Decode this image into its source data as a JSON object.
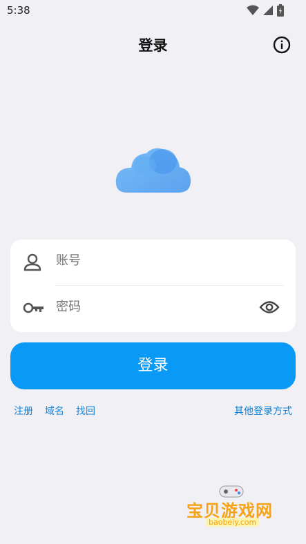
{
  "status_bar": {
    "time": "5:38"
  },
  "app_bar": {
    "title": "登录"
  },
  "form": {
    "account_placeholder": "账号",
    "password_placeholder": "密码"
  },
  "login_button": "登录",
  "links": {
    "register": "注册",
    "domain": "域名",
    "recover": "找回",
    "other_login": "其他登录方式"
  },
  "watermark": {
    "text": "宝贝游戏网",
    "url": "baobeiy.com"
  },
  "colors": {
    "accent": "#0a99f5",
    "link": "#1384d6",
    "background": "#f1f0f5",
    "cloud": "#5aa8f3"
  }
}
